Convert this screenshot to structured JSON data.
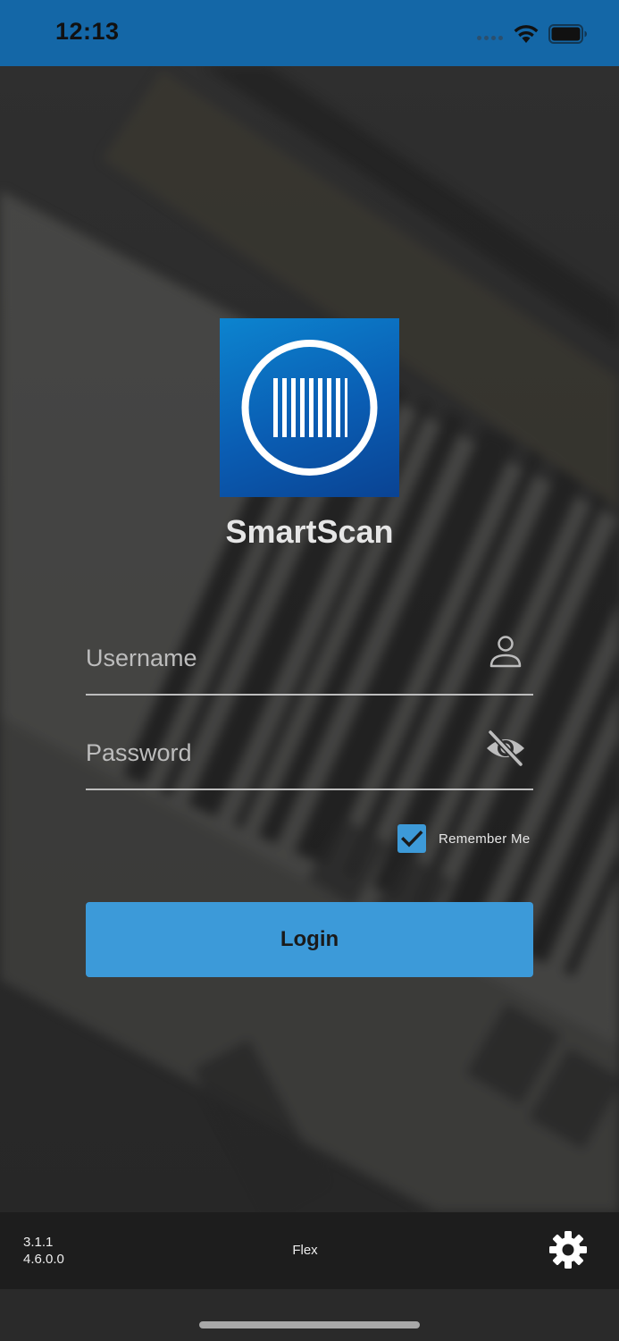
{
  "status_bar": {
    "time": "12:13",
    "background_color": "#1467a7"
  },
  "app": {
    "name": "SmartScan",
    "logo_icon": "barcode-circle-icon",
    "brand_color": "#0a5db3"
  },
  "login_form": {
    "username": {
      "placeholder": "Username",
      "value": "",
      "icon": "person-icon"
    },
    "password": {
      "placeholder": "Password",
      "value": "",
      "icon": "eye-slash-icon"
    },
    "remember_me": {
      "label": "Remember Me",
      "checked": true
    },
    "login_button_label": "Login",
    "accent_color": "#3c9ad9"
  },
  "footer": {
    "app_version": "3.1.1",
    "build_version": "4.6.0.0",
    "mode_label": "Flex",
    "settings_icon": "gear-icon"
  }
}
